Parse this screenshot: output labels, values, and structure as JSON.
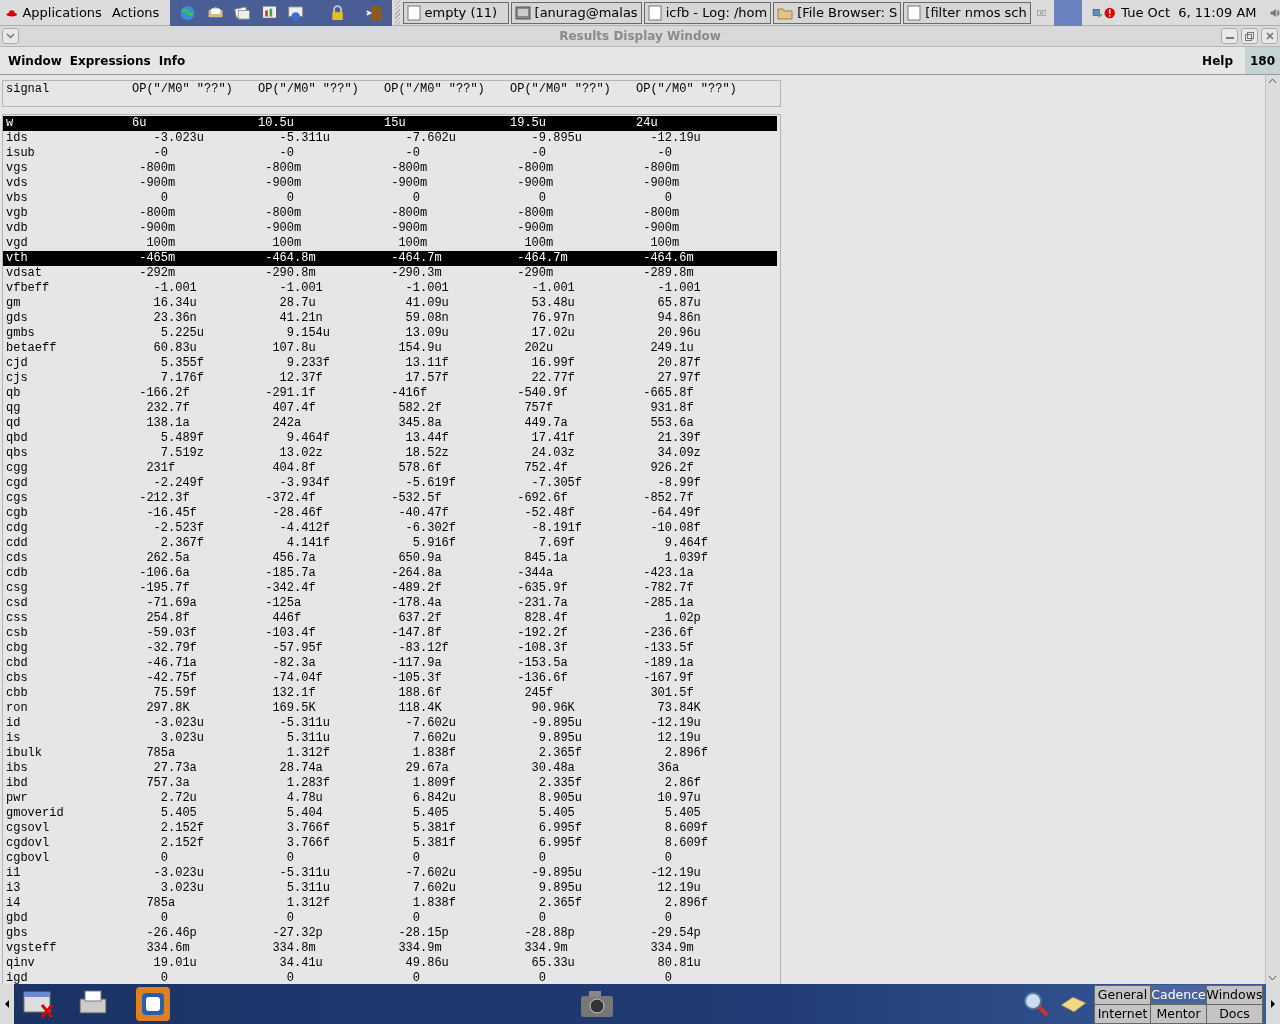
{
  "top_panel": {
    "menus": [
      "Applications",
      "Actions"
    ],
    "tasks": [
      {
        "label": "empty (11)",
        "kind": "document"
      },
      {
        "label": "[anurag@malas",
        "kind": "terminal"
      },
      {
        "label": "icfb - Log: /hom",
        "kind": "document"
      },
      {
        "label": "[File Browser: S",
        "kind": "folder"
      },
      {
        "label": "[filter nmos sch",
        "kind": "document"
      }
    ],
    "clock": "Tue Oct  6, 11:09 AM"
  },
  "window": {
    "title": "Results Display Window",
    "menus": [
      "Window",
      "Expressions",
      "Info"
    ],
    "help": "Help",
    "badge": "180"
  },
  "table": {
    "columns": [
      "signal",
      "OP(\"/M0\" \"??\")",
      "OP(\"/M0\" \"??\")",
      "OP(\"/M0\" \"??\")",
      "OP(\"/M0\" \"??\")",
      "OP(\"/M0\" \"??\")"
    ],
    "rows": [
      {
        "signal": "w",
        "kind": "sweep",
        "selected": true,
        "values": [
          "6u",
          "10.5u",
          "15u",
          "19.5u",
          "24u"
        ]
      },
      {
        "signal": "ids",
        "kind": "value",
        "selected": false,
        "values": [
          "-3.023u",
          "-5.311u",
          "-7.602u",
          "-9.895u",
          "-12.19u"
        ]
      },
      {
        "signal": "isub",
        "kind": "value",
        "selected": false,
        "values": [
          "-0",
          "-0",
          "-0",
          "-0",
          "-0"
        ]
      },
      {
        "signal": "vgs",
        "kind": "value",
        "selected": false,
        "values": [
          "-800m",
          "-800m",
          "-800m",
          "-800m",
          "-800m"
        ]
      },
      {
        "signal": "vds",
        "kind": "value",
        "selected": false,
        "values": [
          "-900m",
          "-900m",
          "-900m",
          "-900m",
          "-900m"
        ]
      },
      {
        "signal": "vbs",
        "kind": "value",
        "selected": false,
        "values": [
          "0",
          "0",
          "0",
          "0",
          "0"
        ]
      },
      {
        "signal": "vgb",
        "kind": "value",
        "selected": false,
        "values": [
          "-800m",
          "-800m",
          "-800m",
          "-800m",
          "-800m"
        ]
      },
      {
        "signal": "vdb",
        "kind": "value",
        "selected": false,
        "values": [
          "-900m",
          "-900m",
          "-900m",
          "-900m",
          "-900m"
        ]
      },
      {
        "signal": "vgd",
        "kind": "value",
        "selected": false,
        "values": [
          "100m",
          "100m",
          "100m",
          "100m",
          "100m"
        ]
      },
      {
        "signal": "vth",
        "kind": "value",
        "selected": true,
        "values": [
          "-465m",
          "-464.8m",
          "-464.7m",
          "-464.7m",
          "-464.6m"
        ]
      },
      {
        "signal": "vdsat",
        "kind": "value",
        "selected": false,
        "values": [
          "-292m",
          "-290.8m",
          "-290.3m",
          "-290m",
          "-289.8m"
        ]
      },
      {
        "signal": "vfbeff",
        "kind": "value",
        "selected": false,
        "values": [
          "-1.001",
          "-1.001",
          "-1.001",
          "-1.001",
          "-1.001"
        ]
      },
      {
        "signal": "gm",
        "kind": "value",
        "selected": false,
        "values": [
          "16.34u",
          "28.7u",
          "41.09u",
          "53.48u",
          "65.87u"
        ]
      },
      {
        "signal": "gds",
        "kind": "value",
        "selected": false,
        "values": [
          "23.36n",
          "41.21n",
          "59.08n",
          "76.97n",
          "94.86n"
        ]
      },
      {
        "signal": "gmbs",
        "kind": "value",
        "selected": false,
        "values": [
          "5.225u",
          "9.154u",
          "13.09u",
          "17.02u",
          "20.96u"
        ]
      },
      {
        "signal": "betaeff",
        "kind": "value",
        "selected": false,
        "values": [
          "60.83u",
          "107.8u",
          "154.9u",
          "202u",
          "249.1u"
        ]
      },
      {
        "signal": "cjd",
        "kind": "value",
        "selected": false,
        "values": [
          "5.355f",
          "9.233f",
          "13.11f",
          "16.99f",
          "20.87f"
        ]
      },
      {
        "signal": "cjs",
        "kind": "value",
        "selected": false,
        "values": [
          "7.176f",
          "12.37f",
          "17.57f",
          "22.77f",
          "27.97f"
        ]
      },
      {
        "signal": "qb",
        "kind": "value",
        "selected": false,
        "values": [
          "-166.2f",
          "-291.1f",
          "-416f",
          "-540.9f",
          "-665.8f"
        ]
      },
      {
        "signal": "qg",
        "kind": "value",
        "selected": false,
        "values": [
          "232.7f",
          "407.4f",
          "582.2f",
          "757f",
          "931.8f"
        ]
      },
      {
        "signal": "qd",
        "kind": "value",
        "selected": false,
        "values": [
          "138.1a",
          "242a",
          "345.8a",
          "449.7a",
          "553.6a"
        ]
      },
      {
        "signal": "qbd",
        "kind": "value",
        "selected": false,
        "values": [
          "5.489f",
          "9.464f",
          "13.44f",
          "17.41f",
          "21.39f"
        ]
      },
      {
        "signal": "qbs",
        "kind": "value",
        "selected": false,
        "values": [
          "7.519z",
          "13.02z",
          "18.52z",
          "24.03z",
          "34.09z"
        ]
      },
      {
        "signal": "cgg",
        "kind": "value",
        "selected": false,
        "values": [
          "231f",
          "404.8f",
          "578.6f",
          "752.4f",
          "926.2f"
        ]
      },
      {
        "signal": "cgd",
        "kind": "value",
        "selected": false,
        "values": [
          "-2.249f",
          "-3.934f",
          "-5.619f",
          "-7.305f",
          "-8.99f"
        ]
      },
      {
        "signal": "cgs",
        "kind": "value",
        "selected": false,
        "values": [
          "-212.3f",
          "-372.4f",
          "-532.5f",
          "-692.6f",
          "-852.7f"
        ]
      },
      {
        "signal": "cgb",
        "kind": "value",
        "selected": false,
        "values": [
          "-16.45f",
          "-28.46f",
          "-40.47f",
          "-52.48f",
          "-64.49f"
        ]
      },
      {
        "signal": "cdg",
        "kind": "value",
        "selected": false,
        "values": [
          "-2.523f",
          "-4.412f",
          "-6.302f",
          "-8.191f",
          "-10.08f"
        ]
      },
      {
        "signal": "cdd",
        "kind": "value",
        "selected": false,
        "values": [
          "2.367f",
          "4.141f",
          "5.916f",
          "7.69f",
          "9.464f"
        ]
      },
      {
        "signal": "cds",
        "kind": "value",
        "selected": false,
        "values": [
          "262.5a",
          "456.7a",
          "650.9a",
          "845.1a",
          "1.039f"
        ]
      },
      {
        "signal": "cdb",
        "kind": "value",
        "selected": false,
        "values": [
          "-106.6a",
          "-185.7a",
          "-264.8a",
          "-344a",
          "-423.1a"
        ]
      },
      {
        "signal": "csg",
        "kind": "value",
        "selected": false,
        "values": [
          "-195.7f",
          "-342.4f",
          "-489.2f",
          "-635.9f",
          "-782.7f"
        ]
      },
      {
        "signal": "csd",
        "kind": "value",
        "selected": false,
        "values": [
          "-71.69a",
          "-125a",
          "-178.4a",
          "-231.7a",
          "-285.1a"
        ]
      },
      {
        "signal": "css",
        "kind": "value",
        "selected": false,
        "values": [
          "254.8f",
          "446f",
          "637.2f",
          "828.4f",
          "1.02p"
        ]
      },
      {
        "signal": "csb",
        "kind": "value",
        "selected": false,
        "values": [
          "-59.03f",
          "-103.4f",
          "-147.8f",
          "-192.2f",
          "-236.6f"
        ]
      },
      {
        "signal": "cbg",
        "kind": "value",
        "selected": false,
        "values": [
          "-32.79f",
          "-57.95f",
          "-83.12f",
          "-108.3f",
          "-133.5f"
        ]
      },
      {
        "signal": "cbd",
        "kind": "value",
        "selected": false,
        "values": [
          "-46.71a",
          "-82.3a",
          "-117.9a",
          "-153.5a",
          "-189.1a"
        ]
      },
      {
        "signal": "cbs",
        "kind": "value",
        "selected": false,
        "values": [
          "-42.75f",
          "-74.04f",
          "-105.3f",
          "-136.6f",
          "-167.9f"
        ]
      },
      {
        "signal": "cbb",
        "kind": "value",
        "selected": false,
        "values": [
          "75.59f",
          "132.1f",
          "188.6f",
          "245f",
          "301.5f"
        ]
      },
      {
        "signal": "ron",
        "kind": "value",
        "selected": false,
        "values": [
          "297.8K",
          "169.5K",
          "118.4K",
          "90.96K",
          "73.84K"
        ]
      },
      {
        "signal": "id",
        "kind": "value",
        "selected": false,
        "values": [
          "-3.023u",
          "-5.311u",
          "-7.602u",
          "-9.895u",
          "-12.19u"
        ]
      },
      {
        "signal": "is",
        "kind": "value",
        "selected": false,
        "values": [
          "3.023u",
          "5.311u",
          "7.602u",
          "9.895u",
          "12.19u"
        ]
      },
      {
        "signal": "ibulk",
        "kind": "value",
        "selected": false,
        "values": [
          "785a",
          "1.312f",
          "1.838f",
          "2.365f",
          "2.896f"
        ]
      },
      {
        "signal": "ibs",
        "kind": "value",
        "selected": false,
        "values": [
          "27.73a",
          "28.74a",
          "29.67a",
          "30.48a",
          "36a"
        ]
      },
      {
        "signal": "ibd",
        "kind": "value",
        "selected": false,
        "values": [
          "757.3a",
          "1.283f",
          "1.809f",
          "2.335f",
          "2.86f"
        ]
      },
      {
        "signal": "pwr",
        "kind": "value",
        "selected": false,
        "values": [
          "2.72u",
          "4.78u",
          "6.842u",
          "8.905u",
          "10.97u"
        ]
      },
      {
        "signal": "gmoverid",
        "kind": "value",
        "selected": false,
        "values": [
          "5.405",
          "5.404",
          "5.405",
          "5.405",
          "5.405"
        ]
      },
      {
        "signal": "cgsovl",
        "kind": "value",
        "selected": false,
        "values": [
          "2.152f",
          "3.766f",
          "5.381f",
          "6.995f",
          "8.609f"
        ]
      },
      {
        "signal": "cgdovl",
        "kind": "value",
        "selected": false,
        "values": [
          "2.152f",
          "3.766f",
          "5.381f",
          "6.995f",
          "8.609f"
        ]
      },
      {
        "signal": "cgbovl",
        "kind": "value",
        "selected": false,
        "values": [
          "0",
          "0",
          "0",
          "0",
          "0"
        ]
      },
      {
        "signal": "i1",
        "kind": "value",
        "selected": false,
        "values": [
          "-3.023u",
          "-5.311u",
          "-7.602u",
          "-9.895u",
          "-12.19u"
        ]
      },
      {
        "signal": "i3",
        "kind": "value",
        "selected": false,
        "values": [
          "3.023u",
          "5.311u",
          "7.602u",
          "9.895u",
          "12.19u"
        ]
      },
      {
        "signal": "i4",
        "kind": "value",
        "selected": false,
        "values": [
          "785a",
          "1.312f",
          "1.838f",
          "2.365f",
          "2.896f"
        ]
      },
      {
        "signal": "gbd",
        "kind": "value",
        "selected": false,
        "values": [
          "0",
          "0",
          "0",
          "0",
          "0"
        ]
      },
      {
        "signal": "gbs",
        "kind": "value",
        "selected": false,
        "values": [
          "-26.46p",
          "-27.32p",
          "-28.15p",
          "-28.88p",
          "-29.54p"
        ]
      },
      {
        "signal": "vgsteff",
        "kind": "value",
        "selected": false,
        "values": [
          "334.6m",
          "334.8m",
          "334.9m",
          "334.9m",
          "334.9m"
        ]
      },
      {
        "signal": "qinv",
        "kind": "value",
        "selected": false,
        "values": [
          "19.01u",
          "34.41u",
          "49.86u",
          "65.33u",
          "80.81u"
        ]
      },
      {
        "signal": "igd",
        "kind": "value",
        "selected": false,
        "values": [
          "0",
          "0",
          "0",
          "0",
          "0"
        ]
      }
    ]
  },
  "workspaces": [
    {
      "label": "General",
      "selected": false
    },
    {
      "label": "Cadence",
      "selected": true
    },
    {
      "label": "Windows",
      "selected": false
    },
    {
      "label": "Internet",
      "selected": false
    },
    {
      "label": "Mentor",
      "selected": false
    },
    {
      "label": "Docs",
      "selected": false
    }
  ]
}
